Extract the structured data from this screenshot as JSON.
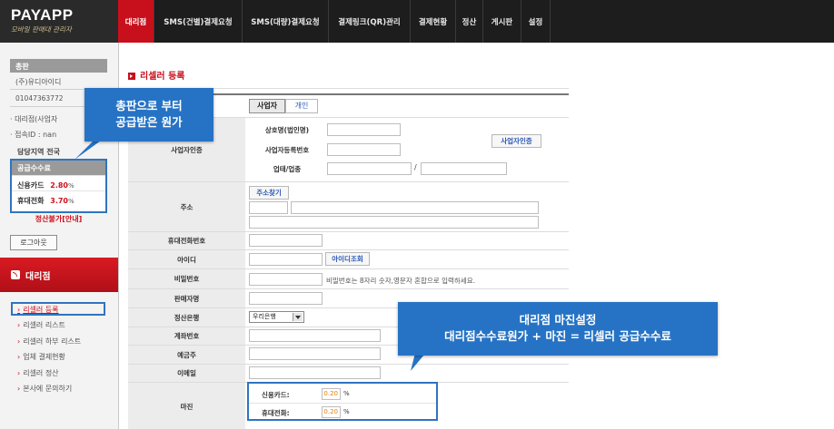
{
  "app": {
    "logo": "PAYAPP",
    "logo_subtitle": "모바일 판매대 관리자"
  },
  "nav": {
    "items": [
      "대리점",
      "SMS(건별)결제요청",
      "SMS(대량)결제요청",
      "결제링크(QR)관리",
      "결제현황",
      "정산",
      "게시판",
      "설정"
    ],
    "active_index": 0
  },
  "sidebar": {
    "distributor_header": "총판",
    "distributor_name": "(주)유디아이디",
    "distributor_phone": "01047363772",
    "agency_label": "대리점(사업자",
    "login_id_label": "접속ID : nan",
    "region_label": "담당지역 전국",
    "fee": {
      "header": "공급수수료",
      "card_label": "신용카드",
      "card_rate": "2.80",
      "phone_label": "휴대전화",
      "phone_rate": "3.70",
      "pct": "%"
    },
    "settle_notice": "정산불가[안내]",
    "logout_label": "로그아웃",
    "section_title": "대리점",
    "menu": [
      "리셀러 등록",
      "리셀러 리스트",
      "리셀러 하부 리스트",
      "업체 결제현황",
      "리셀러 정산",
      "본사에 문의하기"
    ],
    "active_menu_index": 0
  },
  "main": {
    "title": "리셀러 등록",
    "tabs": [
      "사업자",
      "개인"
    ],
    "active_tab_index": 0,
    "business_cert": {
      "label": "사업자인증",
      "company_name_label": "상호명(법인명)",
      "biz_number_label": "사업자등록번호",
      "business_type_label": "업태/업종",
      "slash": "/",
      "verify_button": "사업자인증"
    },
    "address": {
      "label": "주소",
      "search_button": "주소찾기"
    },
    "mobile_label": "휴대전화번호",
    "id": {
      "label": "아이디",
      "check_button": "아이디조회"
    },
    "password": {
      "label": "비밀번호",
      "hint": "비밀번호는 8자리 숫자,영문자 혼합으로 입력하세요."
    },
    "seller_name_label": "판매자명",
    "bank": {
      "label": "정산은행",
      "selected": "우리은행"
    },
    "account_number_label": "계좌번호",
    "depositor_label": "예금주",
    "email_label": "이메일",
    "margin": {
      "label": "마진",
      "card_label": "신용카드:",
      "card_value": "0.20",
      "phone_label": "휴대전화:",
      "phone_value": "0.20",
      "pct": "%"
    }
  },
  "callouts": {
    "supply_cost": [
      "총판으로 부터",
      "공급받은 원가"
    ],
    "margin_setting": [
      "대리점 마진설정",
      "대리점수수료원가 + 마진 = 리셀러 공급수수료"
    ]
  },
  "colors": {
    "brand_red": "#c8101c",
    "callout_blue": "#2673c5",
    "topbar": "#1d1d1d"
  }
}
